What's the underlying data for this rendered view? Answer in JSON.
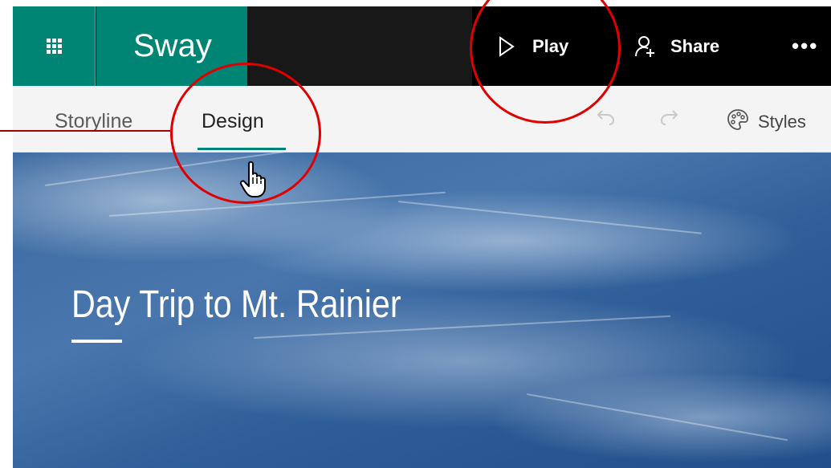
{
  "app": {
    "brand": "Sway",
    "play_label": "Play",
    "share_label": "Share",
    "more_label": "•••"
  },
  "tabs": [
    {
      "label": "Storyline",
      "active": false
    },
    {
      "label": "Design",
      "active": true
    }
  ],
  "toolbar": {
    "styles_label": "Styles"
  },
  "hero": {
    "title": "Day Trip to Mt. Rainier"
  },
  "icons": {
    "app_launcher": "waffle-grid-icon",
    "play": "play-icon",
    "share": "add-person-icon",
    "undo": "undo-icon",
    "redo": "redo-icon",
    "styles": "palette-icon",
    "cursor": "hand-pointer-icon"
  },
  "colors": {
    "brand_green": "#008575",
    "top_bar": "#000000",
    "callout_red": "#e00000",
    "hero_blue": "#3c6aa0"
  }
}
